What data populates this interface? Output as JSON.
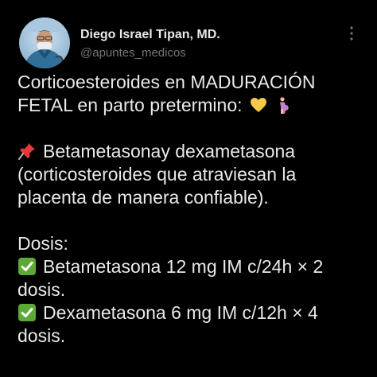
{
  "author": {
    "name": "Diego Israel Tipan, MD.",
    "handle": "@apuntes_medicos"
  },
  "icons": {
    "more": "more-options-icon",
    "heart": "yellow-heart-icon",
    "pregnant": "pregnant-woman-icon",
    "pin": "pushpin-icon",
    "check": "check-mark-button-icon"
  },
  "colors": {
    "background": "#000000",
    "text": "#e7e9ea",
    "secondary": "#71767b",
    "check_green": "#5ca936",
    "heart_yellow": "#f7c948",
    "pin_red": "#e23a3a"
  },
  "tweet": {
    "line1": "Corticoesteroides en MADURACIÓN",
    "line2": "FETAL en parto pretermino:",
    "line3": "Betametasonay dexametasona",
    "line4": "(corticosteroides que atraviesan la",
    "line5": "placenta de manera confiable).",
    "line6": "Dosis:",
    "line7": "Betametasona 12 mg IM c/24h × 2",
    "line8": "dosis.",
    "line9": "Dexametasona 6 mg IM c/12h × 4",
    "line10": "dosis."
  }
}
